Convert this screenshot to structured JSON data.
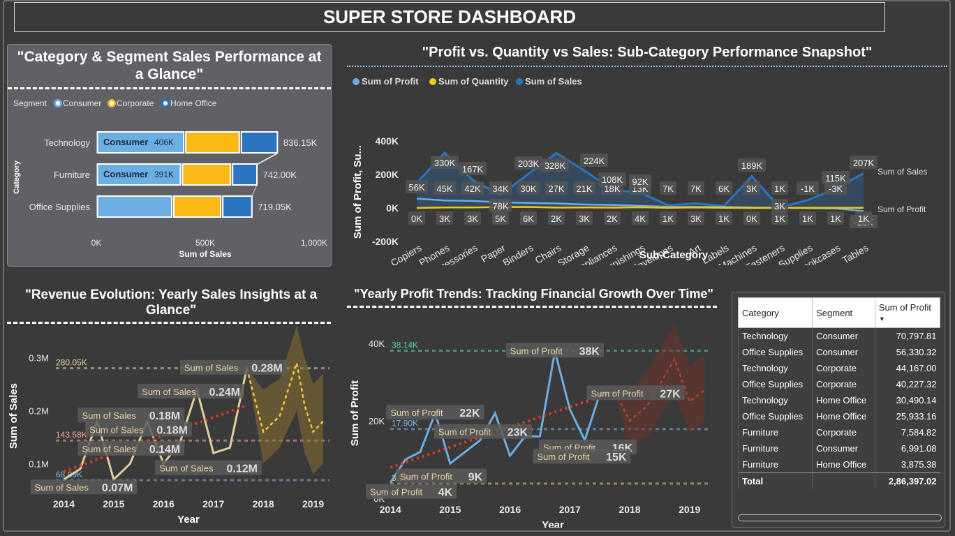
{
  "dashboard_title": "SUPER STORE DASHBOARD",
  "panels": {
    "segment": {
      "title_line1": "\"Category & Segment Sales Performance at",
      "title_line2": "a Glance\""
    },
    "subcat": {
      "title": "\"Profit vs. Quantity vs Sales: Sub-Category Performance Snapshot\""
    },
    "revenue": {
      "title_line1": "\"Revenue Evolution: Yearly Sales Insights at a",
      "title_line2": "Glance\""
    },
    "profit": {
      "title": "\"Yearly Profit Trends: Tracking Financial Growth Over Time\""
    }
  },
  "colors": {
    "consumer": "#6aaee3",
    "corporate": "#fbb916",
    "home_office": "#2b75c0",
    "quantity": "#f2c811",
    "sales_line": "#e0cf9a",
    "forecast": "#b08a2e",
    "trend": "#d93a1c",
    "profit_line": "#6aaee3",
    "profit_forecast": "#8a3a2a"
  },
  "chart_data": [
    {
      "id": "category_segment",
      "type": "bar",
      "orientation": "horizontal",
      "stacked": true,
      "legend_title": "Segment",
      "xlabel": "Sum of Sales",
      "ylabel": "Category",
      "xlim": [
        0,
        1000000
      ],
      "x_ticks": [
        "0K",
        "500K",
        "1,000K"
      ],
      "categories": [
        "Technology",
        "Furniture",
        "Office Supplies"
      ],
      "series": [
        {
          "name": "Consumer",
          "values": [
            406000,
            391000,
            351000
          ]
        },
        {
          "name": "Corporate",
          "values": [
            255000,
            230000,
            225000
          ]
        },
        {
          "name": "Home Office",
          "values": [
            175150,
            121000,
            143050
          ]
        }
      ],
      "data_labels": [
        {
          "segment": "Consumer",
          "value": "406K"
        },
        {
          "segment": "Consumer",
          "value": "391K"
        }
      ],
      "totals": [
        "836.15K",
        "742.00K",
        "719.05K"
      ]
    },
    {
      "id": "subcategory",
      "type": "line",
      "xlabel": "Sub-Category",
      "ylabel": "Sum of Profit, Su...",
      "ylim": [
        -200000,
        400000
      ],
      "y_ticks": [
        "400K",
        "200K",
        "0K",
        "-200K"
      ],
      "categories": [
        "Copiers",
        "Phones",
        "Accessories",
        "Paper",
        "Binders",
        "Chairs",
        "Storage",
        "Appliances",
        "Furnishings",
        "Envelopes",
        "Art",
        "Labels",
        "Machines",
        "Fasteners",
        "Supplies",
        "Bookcases",
        "Tables"
      ],
      "series": [
        {
          "name": "Sum of Profit",
          "values": [
            56000,
            45000,
            42000,
            34000,
            30000,
            27000,
            21000,
            18000,
            13000,
            7000,
            7000,
            6000,
            3000,
            1000,
            -1000,
            -3000,
            -18000
          ],
          "labels": [
            "56K",
            "45K",
            "42K",
            "34K",
            "30K",
            "27K",
            "21K",
            "18K",
            "13K",
            "7K",
            "7K",
            "6K",
            "3K",
            "1K",
            "-1K",
            "-3K",
            "-18K"
          ]
        },
        {
          "name": "Sum of Quantity",
          "values": [
            0,
            3000,
            3000,
            5000,
            6000,
            2000,
            3000,
            2000,
            4000,
            1000,
            3000,
            1000,
            0,
            1000,
            1000,
            1000,
            1000
          ],
          "labels": [
            "0K",
            "3K",
            "3K",
            "5K",
            "6K",
            "2K",
            "3K",
            "2K",
            "4K",
            "1K",
            "3K",
            "1K",
            "0K",
            "1K",
            "1K",
            "1K",
            "1K"
          ]
        },
        {
          "name": "Sum of Sales",
          "values": [
            150000,
            330000,
            167000,
            78000,
            203000,
            328000,
            224000,
            108000,
            92000,
            16000,
            27000,
            12000,
            189000,
            3000,
            47000,
            115000,
            207000
          ],
          "labels": [
            "",
            "330K",
            "167K",
            "78K",
            "203K",
            "328K",
            "224K",
            "108K",
            "92K",
            "",
            "",
            "",
            "189K",
            "3K",
            "",
            "115K",
            "207K"
          ]
        }
      ],
      "end_labels": {
        "sales": "Sum of Sales",
        "profit": "Sum of Profit"
      }
    },
    {
      "id": "yearly_sales",
      "type": "line",
      "xlabel": "Year",
      "ylabel": "Sum of Sales",
      "ylim": [
        0.045,
        0.335
      ],
      "y_unit": "M",
      "y_ticks": [
        {
          "v": 0.3,
          "label": "0.3M"
        },
        {
          "v": 0.2,
          "label": "0.2M"
        },
        {
          "v": 0.1,
          "label": "0.1M"
        }
      ],
      "x_range": [
        2013.7,
        2019.3
      ],
      "x_ticks": [
        2014,
        2015,
        2016,
        2017,
        2018,
        2019
      ],
      "series": [
        {
          "name": "Sum of Sales",
          "x": [
            2014.0,
            2014.33,
            2014.67,
            2015.0,
            2015.33,
            2015.67,
            2016.0,
            2016.33,
            2016.67,
            2017.0,
            2017.33,
            2017.67
          ],
          "values": [
            0.07,
            0.09,
            0.18,
            0.07,
            0.1,
            0.18,
            0.1,
            0.14,
            0.24,
            0.12,
            0.13,
            0.28
          ]
        }
      ],
      "forecast": {
        "x": [
          2017.67,
          2018.0,
          2018.33,
          2018.67,
          2018.83,
          2019.0,
          2019.2
        ],
        "values": [
          0.28,
          0.16,
          0.19,
          0.29,
          0.21,
          0.16,
          0.18
        ],
        "upper": [
          0.28,
          0.24,
          0.26,
          0.36,
          0.3,
          0.25,
          0.27
        ],
        "lower": [
          0.28,
          0.1,
          0.13,
          0.2,
          0.12,
          0.08,
          0.1
        ]
      },
      "reference_lines": [
        {
          "value": 0.28005,
          "label": "280.05K",
          "color": "#e6d3a3"
        },
        {
          "value": 0.14358,
          "label": "143.58K",
          "color": "#f0a898"
        },
        {
          "value": 0.06888,
          "label": "68.89K",
          "color": "#7ab5e6"
        }
      ],
      "trend": {
        "x": [
          2014.0,
          2017.67
        ],
        "values": [
          0.085,
          0.21
        ]
      },
      "annotations": [
        {
          "x": 2017.4,
          "y": 0.28,
          "text": "Sum of Sales",
          "value": "0.28M"
        },
        {
          "x": 2016.55,
          "y": 0.235,
          "text": "Sum of Sales",
          "value": "0.24M"
        },
        {
          "x": 2015.35,
          "y": 0.19,
          "text": "Sum of Sales",
          "value": "0.18M"
        },
        {
          "x": 2015.5,
          "y": 0.163,
          "text": "Sum of Sales",
          "value": "0.18M"
        },
        {
          "x": 2015.35,
          "y": 0.127,
          "text": "Sum of Sales",
          "value": "0.14M"
        },
        {
          "x": 2016.9,
          "y": 0.0905,
          "text": "Sum of Sales",
          "value": "0.12M"
        },
        {
          "x": 2014.4,
          "y": 0.054,
          "text": "Sum of Sales",
          "value": "0.07M"
        }
      ]
    },
    {
      "id": "yearly_profit",
      "type": "line",
      "xlabel": "Year",
      "ylabel": "Sum of Profit",
      "ylim": [
        0,
        44000
      ],
      "y_ticks": [
        {
          "v": 40000,
          "label": "40K"
        },
        {
          "v": 20000,
          "label": "20K"
        },
        {
          "v": 0,
          "label": "0K"
        }
      ],
      "x_range": [
        2013.8,
        2019.4
      ],
      "x_ticks": [
        2014,
        2015,
        2016,
        2017,
        2018,
        2019
      ],
      "series": [
        {
          "name": "Sum of Profit",
          "x": [
            2014.0,
            2014.25,
            2014.5,
            2014.75,
            2015.0,
            2015.25,
            2015.5,
            2015.75,
            2016.0,
            2016.25,
            2016.5,
            2016.75,
            2017.0,
            2017.25,
            2017.5,
            2017.75
          ],
          "values": [
            4000,
            10000,
            12000,
            22000,
            9000,
            12000,
            15000,
            22000,
            11000,
            16000,
            16000,
            38000,
            23000,
            15000,
            27000,
            27500
          ]
        }
      ],
      "forecast": {
        "x": [
          2017.75,
          2018.0,
          2018.3,
          2018.75,
          2019.0,
          2019.25
        ],
        "values": [
          27500,
          20000,
          24000,
          36000,
          25000,
          28000
        ],
        "upper": [
          27500,
          28000,
          33000,
          45000,
          34000,
          37000
        ],
        "lower": [
          27500,
          13000,
          16000,
          27000,
          17000,
          20000
        ]
      },
      "reference_lines": [
        {
          "value": 38140,
          "label": "38.14K",
          "color": "#5fd0b0"
        },
        {
          "value": 17900,
          "label": "17.90K",
          "color": "#7ab5e6"
        },
        {
          "value": 3810,
          "label": "3.81K",
          "color": "#e6c86a"
        }
      ],
      "trend": {
        "x": [
          2014.0,
          2017.75
        ],
        "values": [
          8000,
          27500
        ]
      },
      "annotations": [
        {
          "x": 2016.75,
          "y": 38000,
          "text": "Sum of Profit",
          "value": "38K"
        },
        {
          "x": 2018.1,
          "y": 27000,
          "text": "Sum of Profit",
          "value": "27K"
        },
        {
          "x": 2014.75,
          "y": 22000,
          "text": "Sum of Profit",
          "value": "22K"
        },
        {
          "x": 2015.55,
          "y": 17000,
          "text": "Sum of Profit",
          "value": "23K"
        },
        {
          "x": 2017.3,
          "y": 13000,
          "text": "Sum of Profit",
          "value": "16K"
        },
        {
          "x": 2017.2,
          "y": 10600,
          "text": "Sum of Profit",
          "value": "15K"
        },
        {
          "x": 2014.85,
          "y": 5500,
          "text": "Sum of Profit",
          "value": "9K"
        },
        {
          "x": 2014.35,
          "y": 1500,
          "text": "Sum of Profit",
          "value": "4K"
        }
      ]
    }
  ],
  "table": {
    "headers": [
      "Category",
      "Segment",
      "Sum of Profit"
    ],
    "rows": [
      [
        "Technology",
        "Consumer",
        "70,797.81"
      ],
      [
        "Office Supplies",
        "Consumer",
        "56,330.32"
      ],
      [
        "Technology",
        "Corporate",
        "44,167.00"
      ],
      [
        "Office Supplies",
        "Corporate",
        "40,227.32"
      ],
      [
        "Technology",
        "Home Office",
        "30,490.14"
      ],
      [
        "Office Supplies",
        "Home Office",
        "25,933.16"
      ],
      [
        "Furniture",
        "Corporate",
        "7,584.82"
      ],
      [
        "Furniture",
        "Consumer",
        "6,991.08"
      ],
      [
        "Furniture",
        "Home Office",
        "3,875.38"
      ]
    ],
    "total_label": "Total",
    "total_value": "2,86,397.02"
  }
}
